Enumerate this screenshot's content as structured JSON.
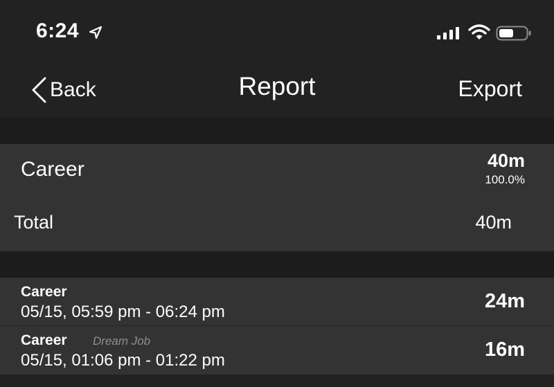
{
  "status_bar": {
    "time": "6:24",
    "icons": [
      "location-arrow-icon",
      "signal-icon",
      "wifi-icon",
      "battery-icon"
    ]
  },
  "nav": {
    "back_label": "Back",
    "title": "Report",
    "export_label": "Export"
  },
  "summary": {
    "category": "Career",
    "duration": "40m",
    "percent": "100.0%",
    "total_label": "Total",
    "total_value": "40m"
  },
  "sessions": [
    {
      "category": "Career",
      "note": "",
      "time_range": "05/15, 05:59 pm - 06:24 pm",
      "duration": "24m"
    },
    {
      "category": "Career",
      "note": "Dream Job",
      "time_range": "05/15, 01:06 pm - 01:22 pm",
      "duration": "16m"
    }
  ],
  "colors": {
    "background": "#222222",
    "section_bg": "#333333",
    "separator_bg": "#1c1c1c",
    "text": "#ffffff",
    "muted_text": "#8e8e8e"
  }
}
